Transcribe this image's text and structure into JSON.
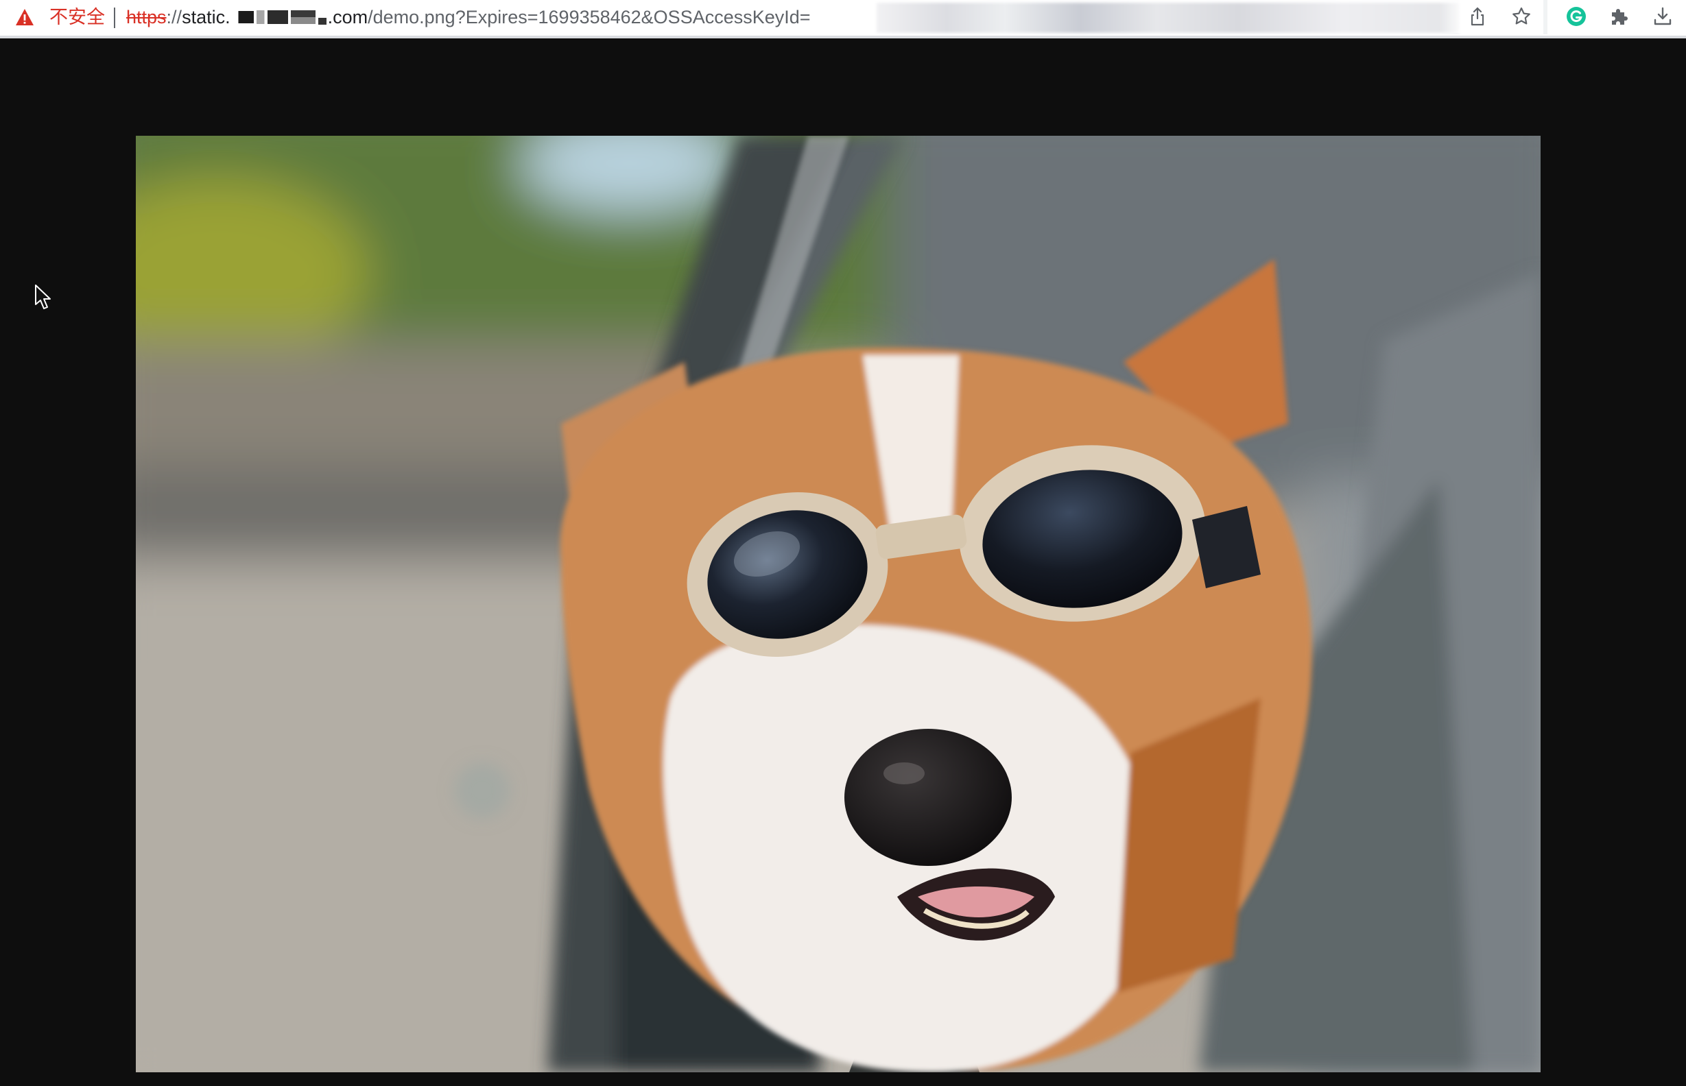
{
  "toolbar": {
    "security_label": "不安全",
    "url": {
      "scheme": "https",
      "separator": "://",
      "host_prefix": "static.",
      "host_suffix": ".com",
      "path": "/demo.png?Expires=1699358462&OSSAccessKeyId="
    },
    "icons": [
      "warning-icon",
      "share-icon",
      "star-icon",
      "grammarly-icon",
      "puzzle-icon",
      "download-icon"
    ]
  },
  "colors": {
    "insecure": "#d93025",
    "page_background": "#0e0e0e",
    "grammarly": "#15c39a"
  }
}
